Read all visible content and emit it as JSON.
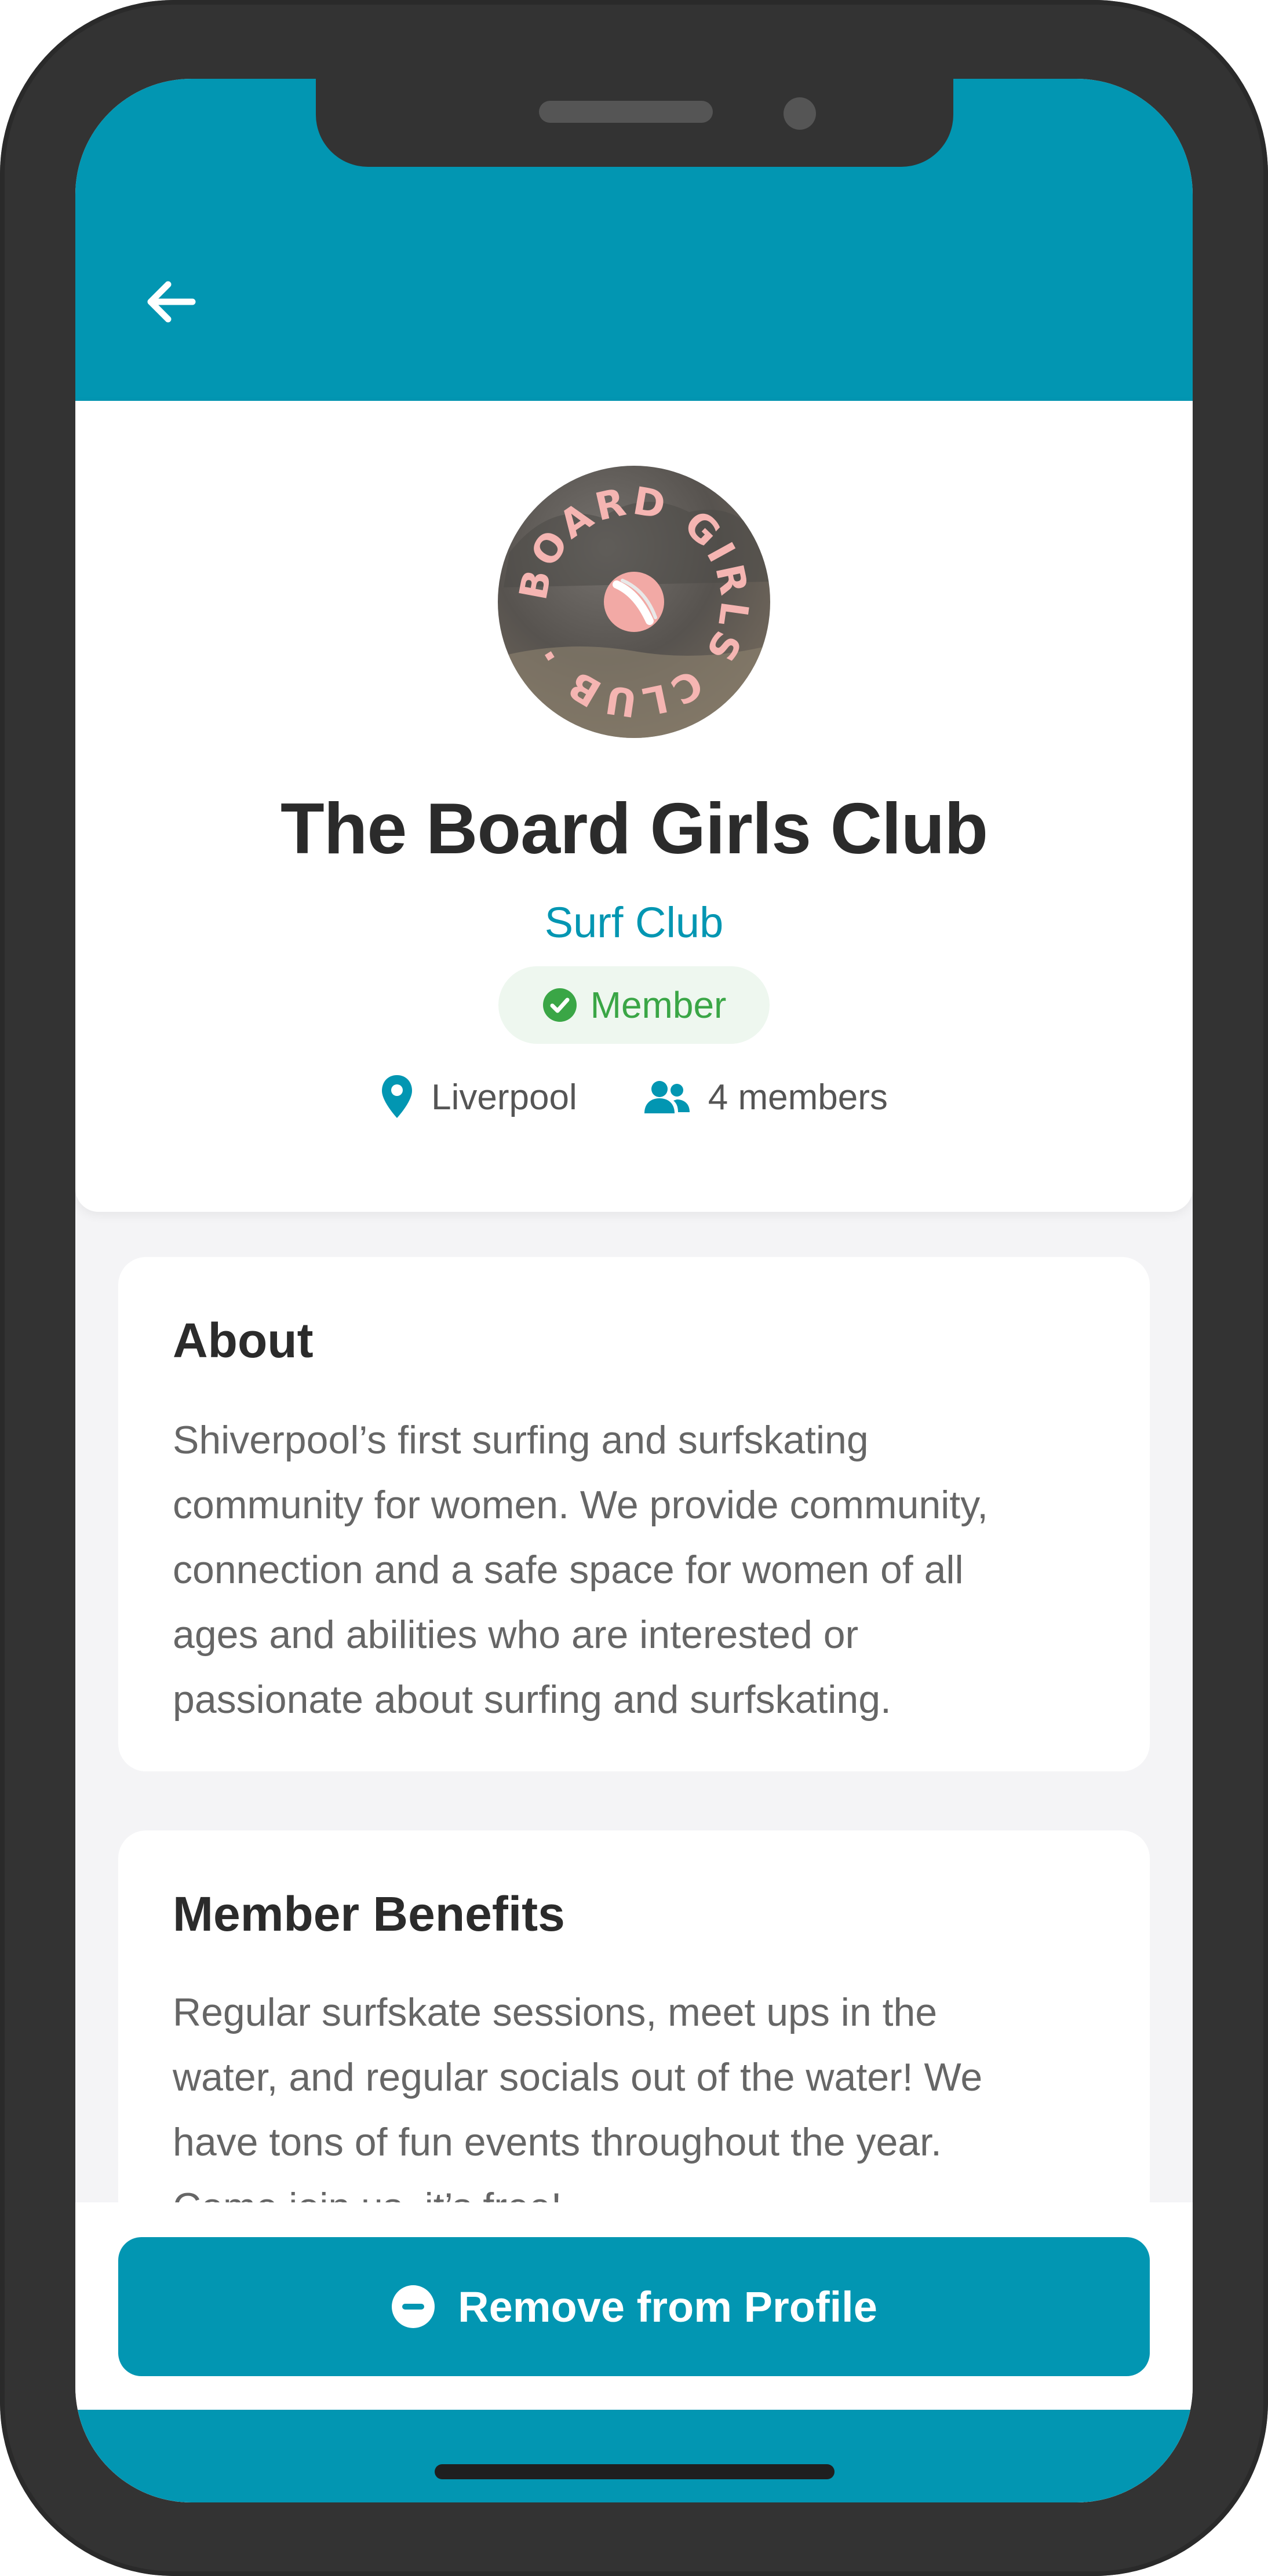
{
  "colors": {
    "accent": "#0296b2",
    "member_green": "#3aa646",
    "title": "#2b2b2b",
    "body_text": "#666666"
  },
  "header": {
    "back_icon": "arrow-left-icon"
  },
  "club": {
    "logo_text": "BOARD GIRLS CLUB",
    "name": "The Board Girls Club",
    "type": "Surf Club",
    "membership_status": "Member",
    "location": "Liverpool",
    "members": "4 members"
  },
  "about": {
    "title": "About",
    "lines": [
      "Shiverpool’s first surfing and surfskating",
      "community for women. We provide community,",
      "connection and a safe space for women of all",
      "ages and abilities who are interested or",
      "passionate about surfing and surfskating."
    ]
  },
  "benefits": {
    "title": "Member Benefits",
    "lines": [
      "Regular surfskate sessions, meet ups in the",
      "water, and regular socials out of the water! We",
      "have tons of fun events throughout the year.",
      "Come join us, it’s free!"
    ]
  },
  "actions": {
    "remove_label": "Remove from Profile",
    "remove_icon": "minus-circle-icon"
  }
}
